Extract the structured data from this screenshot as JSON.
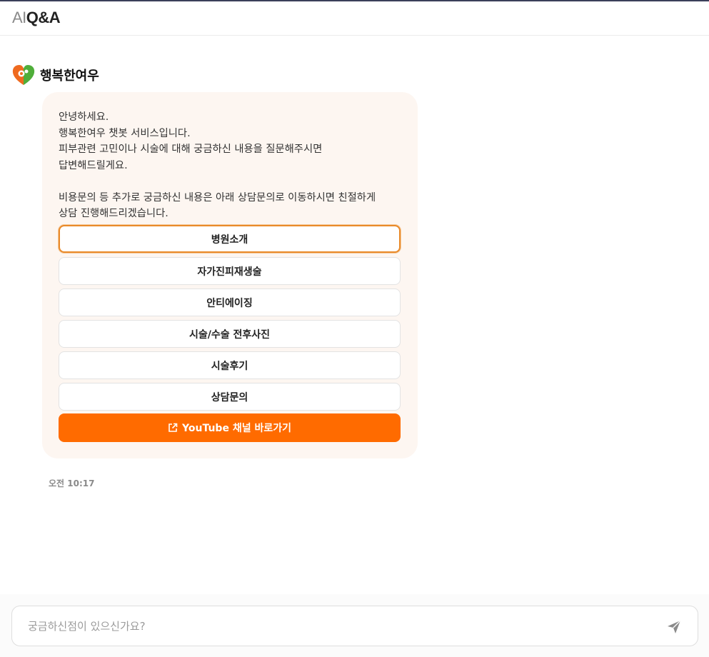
{
  "header": {
    "logo_ai": "AI",
    "logo_rest": "Q&A"
  },
  "bot": {
    "name": "행복한여우",
    "avatar_icon": "fox-heart-logo-icon"
  },
  "message": {
    "lines": [
      "안녕하세요.",
      "행복한여우 챗봇 서비스입니다.",
      "피부관련 고민이나 시술에 대해 궁금하신 내용을 질문해주시면",
      "답변해드릴게요.",
      "",
      "비용문의 등 추가로 궁금하신 내용은 아래 상담문의로 이동하시면 친절하게",
      "상담 진행해드리겠습니다."
    ],
    "time": "오전 10:17"
  },
  "options": [
    {
      "label": "병원소개",
      "selected": true
    },
    {
      "label": "자가진피재생술",
      "selected": false
    },
    {
      "label": "안티에이징",
      "selected": false
    },
    {
      "label": "시술/수술 전후사진",
      "selected": false
    },
    {
      "label": "시술후기",
      "selected": false
    },
    {
      "label": "상담문의",
      "selected": false
    }
  ],
  "youtube_button": {
    "label": "YouTube 채널 바로가기",
    "icon": "external-link-icon"
  },
  "input": {
    "placeholder": "궁금하신점이 있으신가요?",
    "value": ""
  },
  "send_icon": "paper-plane-icon",
  "colors": {
    "accent": "#ff6b00",
    "bubble_bg": "#fdf6f1",
    "selected_border": "#e98a2a"
  }
}
